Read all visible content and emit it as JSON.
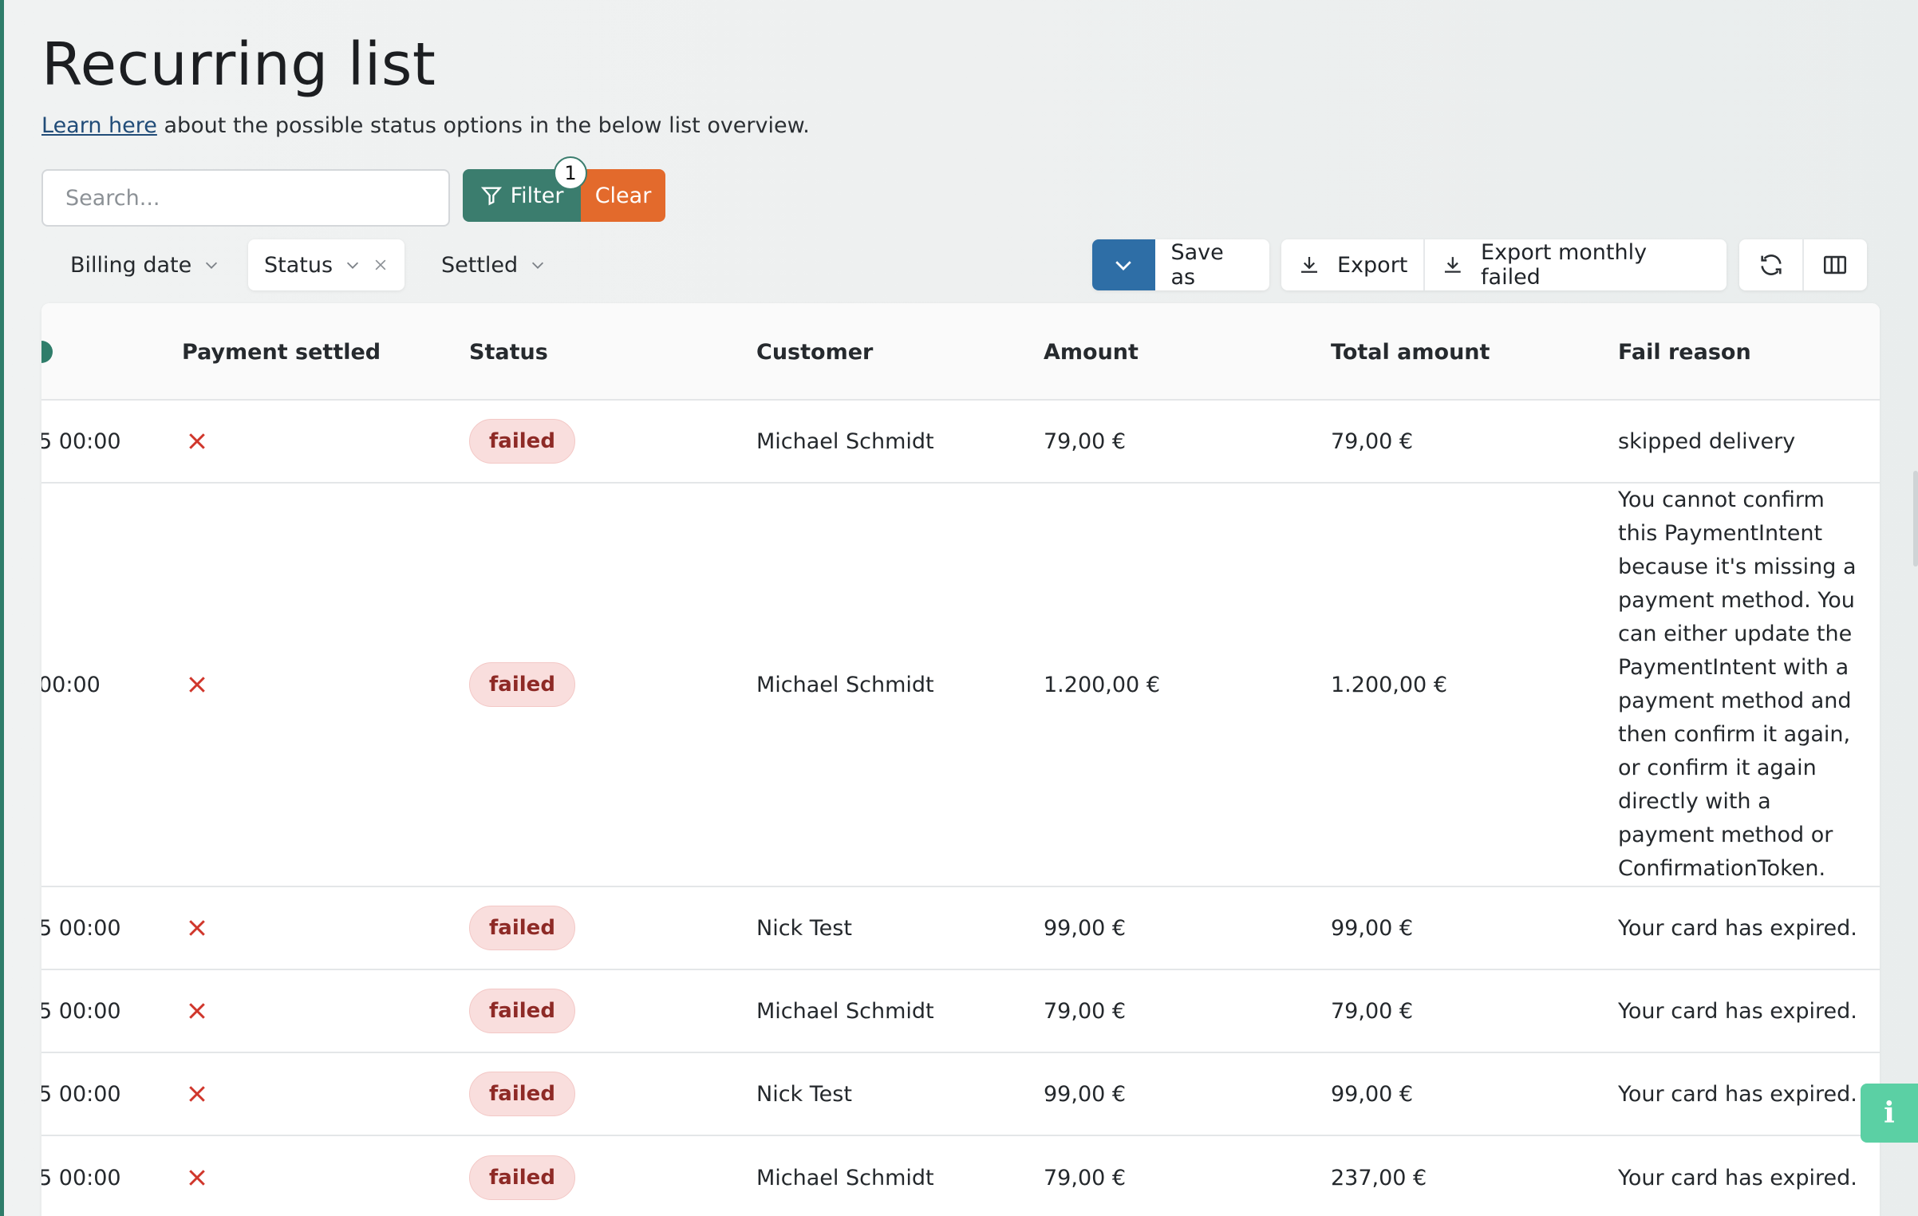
{
  "page": {
    "title": "Recurring list",
    "subtitle_link": "Learn here",
    "subtitle_rest": " about the possible status options in the below list overview."
  },
  "search": {
    "placeholder": "Search..."
  },
  "filter": {
    "label": "Filter",
    "clear_label": "Clear",
    "active_count": "1"
  },
  "chips": {
    "billing_date": "Billing date",
    "status": "Status",
    "settled": "Settled"
  },
  "actions": {
    "save_as": "Save as",
    "export": "Export",
    "export_monthly_failed": "Export monthly failed"
  },
  "table": {
    "columns": {
      "payment_settled": "Payment settled",
      "status": "Status",
      "customer": "Customer",
      "amount": "Amount",
      "total_amount": "Total amount",
      "fail_reason": "Fail reason"
    },
    "rows": [
      {
        "date": "5 00:00",
        "status": "failed",
        "customer": "Michael Schmidt",
        "amount": "79,00 €",
        "total": "79,00 €",
        "reason": "skipped delivery"
      },
      {
        "date": " 00:00",
        "status": "failed",
        "customer": "Michael Schmidt",
        "amount": "1.200,00 €",
        "total": "1.200,00 €",
        "reason": "You cannot confirm this PaymentIntent because it's missing a payment method. You can either update the PaymentIntent with a payment method and then confirm it again, or confirm it again directly with a payment method or ConfirmationToken."
      },
      {
        "date": "5 00:00",
        "status": "failed",
        "customer": "Nick Test",
        "amount": "99,00 €",
        "total": "99,00 €",
        "reason": "Your card has expired."
      },
      {
        "date": "5 00:00",
        "status": "failed",
        "customer": "Michael Schmidt",
        "amount": "79,00 €",
        "total": "79,00 €",
        "reason": "Your card has expired."
      },
      {
        "date": "5 00:00",
        "status": "failed",
        "customer": "Nick Test",
        "amount": "99,00 €",
        "total": "99,00 €",
        "reason": "Your card has expired."
      },
      {
        "date": "5 00:00",
        "status": "failed",
        "customer": "Michael Schmidt",
        "amount": "79,00 €",
        "total": "237,00 €",
        "reason": "Your card has expired."
      }
    ]
  },
  "colors": {
    "primary_green": "#3b7d6e",
    "clear_orange": "#e36a2c",
    "save_blue": "#2e6ea6",
    "failed_badge_bg": "#f9dedd",
    "failed_badge_text": "#8e2a26",
    "not_settled_x": "#d0362b",
    "info_tab": "#5bd0a4"
  },
  "icons": {
    "filter": "funnel-icon",
    "chevron": "chevron-down-icon",
    "remove": "close-icon",
    "download": "download-icon",
    "refresh": "refresh-icon",
    "columns": "columns-icon",
    "info": "info-icon",
    "not_settled": "x-mark-icon"
  }
}
